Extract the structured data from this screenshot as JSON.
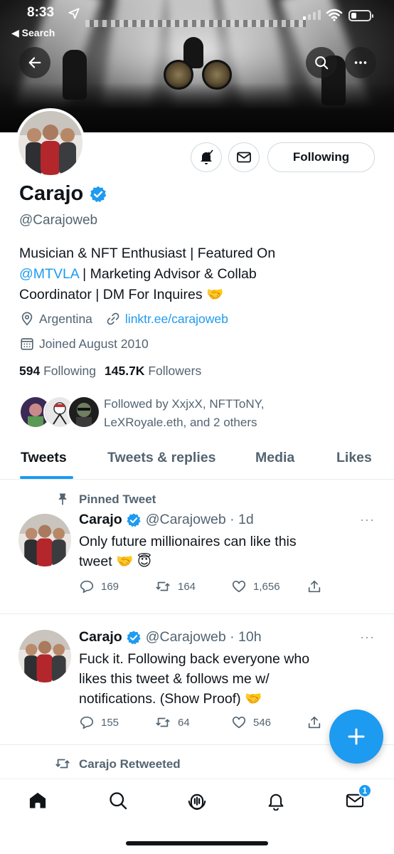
{
  "status_bar": {
    "time": "8:33",
    "back_app": "◀ Search"
  },
  "profile": {
    "display_name": "Carajo",
    "handle": "@Carajoweb",
    "bio": {
      "line1": "Musician & NFT Enthusiast | Featured On",
      "mention": "@MTVLA",
      "line2_rest": " | Marketing Advisor & Collab",
      "line3": "Coordinator | DM For Inquires ",
      "emoji": "🤝"
    },
    "location": "Argentina",
    "website": "linktr.ee/carajoweb",
    "joined": "Joined August 2010",
    "following_count": "594",
    "following_label": "Following",
    "followers_count": "145.7K",
    "followers_label": "Followers",
    "followed_by_line1": "Followed by XxjxX, NFTToNY,",
    "followed_by_line2": "LeXRoyale.eth, and 2 others",
    "follow_button_label": "Following"
  },
  "tabs": [
    {
      "label": "Tweets",
      "active": true
    },
    {
      "label": "Tweets & replies",
      "active": false
    },
    {
      "label": "Media",
      "active": false
    },
    {
      "label": "Likes",
      "active": false
    }
  ],
  "tweets": [
    {
      "context": "Pinned Tweet",
      "name": "Carajo",
      "handle_time": "@Carajoweb · 1d",
      "line1": "Only future millionaires can like this",
      "line2": "tweet",
      "emoji": "🤝 😇",
      "replies": "169",
      "retweets": "164",
      "likes": "1,656"
    },
    {
      "name": "Carajo",
      "handle_time": "@Carajoweb · 10h",
      "line1": "Fuck it. Following back everyone who",
      "line2": "likes this tweet & follows me w/",
      "line3": "notifications. (Show Proof) ",
      "emoji": "🤝",
      "replies": "155",
      "retweets": "64",
      "likes": "546"
    }
  ],
  "retweet_context": "Carajo Retweeted",
  "nav": {
    "messages_badge": "1"
  },
  "colors": {
    "accent": "#1d9bf0",
    "secondary_text": "#536471",
    "primary_text": "#0f1419"
  },
  "icons": [
    "back-arrow-icon",
    "search-icon",
    "more-icon",
    "bell-icon",
    "mail-icon",
    "verified-icon",
    "location-icon",
    "link-icon",
    "calendar-icon",
    "pin-icon",
    "reply-icon",
    "retweet-icon",
    "like-icon",
    "share-icon",
    "compose-icon",
    "home-icon",
    "spaces-icon",
    "notifications-icon",
    "messages-icon"
  ]
}
